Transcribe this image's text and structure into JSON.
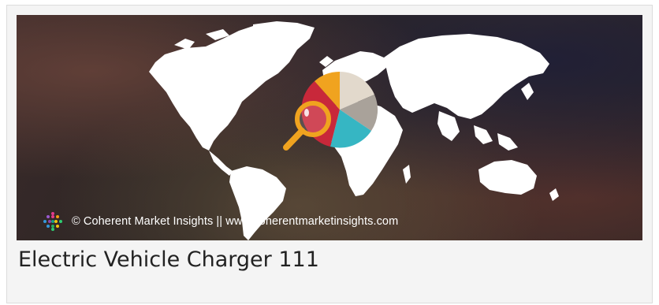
{
  "banner": {
    "image_alt": "world map with pie chart and magnifying glass",
    "watermark_text": "© Coherent Market Insights || www.coherentmarketinsights.com",
    "pie_colors": [
      "#e2d9cc",
      "#a9a29a",
      "#36b6c3",
      "#c8283a",
      "#f0a31f"
    ],
    "magnifier_color": "#f0a31f",
    "map_color": "#ffffff"
  },
  "caption": {
    "title": "Electric Vehicle Charger 111"
  }
}
